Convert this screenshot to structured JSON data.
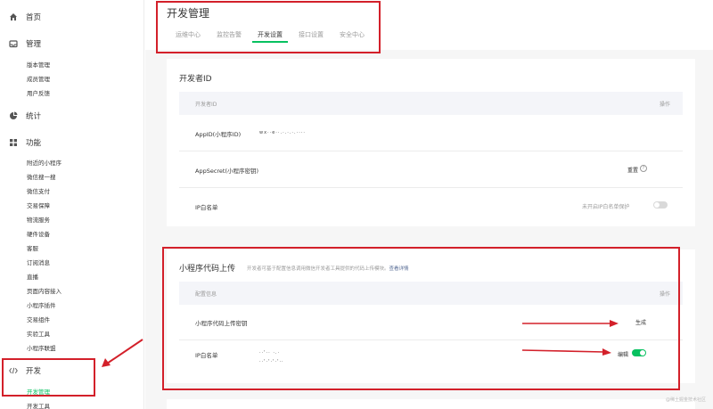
{
  "sidebar": {
    "home": "首页",
    "manage": "管理",
    "manage_items": [
      "版本管理",
      "成员管理",
      "用户反馈"
    ],
    "stats": "统计",
    "features": "功能",
    "feature_items": [
      "附近的小程序",
      "微信搜一搜",
      "微信支付",
      "交易保障",
      "物流服务",
      "硬件设备",
      "客服",
      "订阅消息",
      "直播",
      "页面内容接入",
      "小程序插件",
      "交易组件",
      "实验工具",
      "小程序联盟"
    ],
    "develop": "开发",
    "develop_items": [
      "开发管理",
      "开发工具"
    ]
  },
  "header": {
    "title": "开发管理",
    "tabs": [
      "运维中心",
      "监控告警",
      "开发设置",
      "接口设置",
      "安全中心"
    ],
    "active_tab": "开发设置"
  },
  "developer_id": {
    "title": "开发者ID",
    "col_id": "开发者ID",
    "col_action": "操作",
    "appid_label": "AppID(小程序ID)",
    "appid_value": "wx··e··.·.·.·.····",
    "secret_label": "AppSecret(小程序密钥)",
    "secret_action": "重置",
    "ip_label": "IP白名单",
    "ip_status": "未开启IP白名单保护",
    "ip_enabled": false
  },
  "upload": {
    "title": "小程序代码上传",
    "desc": "开发者可基于配置信息调用微信开发者工具提供的代码上传模块。",
    "link": "查看详情",
    "col_config": "配置信息",
    "col_action": "操作",
    "key_label": "小程序代码上传密钥",
    "key_action": "生成",
    "ip_label": "IP白名单",
    "ip_line1": "··'·· ·.·",
    "ip_line2": "··'·'·'·'··",
    "ip_action": "编辑",
    "ip_enabled": true
  },
  "watermark": "@稀土掘金技术社区",
  "colors": {
    "accent": "#07c160",
    "annotation_red": "#d3202a",
    "link": "#576b95"
  }
}
